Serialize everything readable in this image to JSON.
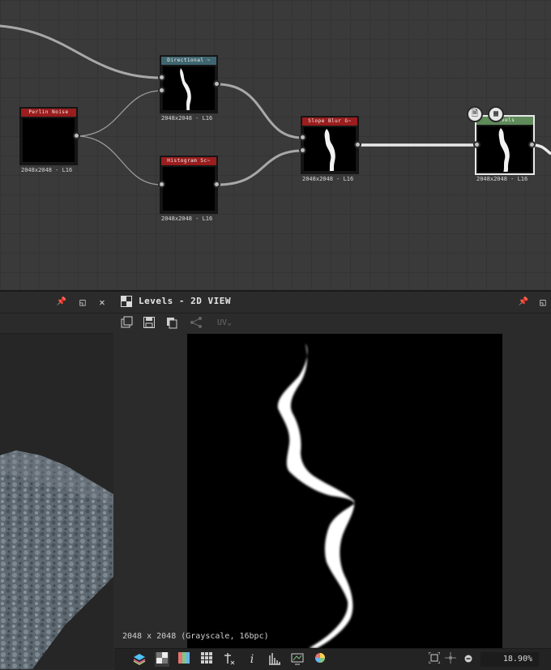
{
  "graph": {
    "nodes": [
      {
        "id": "perlin",
        "title": "Perlin Noise",
        "header_color": "#9b1d1d",
        "size_label": "2048x2048 - L16"
      },
      {
        "id": "directional",
        "title": "Directional ~",
        "header_color": "#3f6670",
        "size_label": "2048x2048 - L16"
      },
      {
        "id": "histogram",
        "title": "Histogram Sc~",
        "header_color": "#9b1d1d",
        "size_label": "2048x2048 - L16"
      },
      {
        "id": "slope",
        "title": "Slope Blur G~",
        "header_color": "#9b1d1d",
        "size_label": "2048x2048 - L16"
      },
      {
        "id": "levels",
        "title": "Levels",
        "header_color": "#5f8a5a",
        "size_label": "2048x2048 - L16"
      }
    ],
    "badges": {
      "doc_icon": "🗎",
      "checker_icon": "▦"
    }
  },
  "left_panel": {
    "icons": {
      "pin": "📌",
      "float": "◱",
      "close": "✕"
    }
  },
  "view2d": {
    "title": "Levels - 2D VIEW",
    "toolbar": {
      "uv_label": "UV⌄"
    },
    "image_info": "2048 x 2048 (Grayscale, 16bpc)",
    "zoom": "18.90%"
  },
  "colors": {
    "accent_green": "#5f8a5a",
    "header_red": "#9b1d1d",
    "header_teal": "#3f6670"
  }
}
